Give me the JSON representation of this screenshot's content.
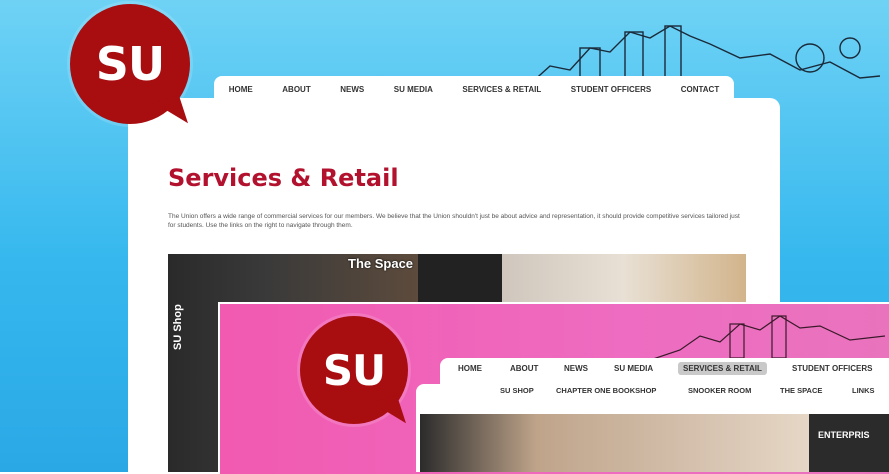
{
  "main": {
    "logo_text": "SU",
    "nav": [
      "HOME",
      "ABOUT",
      "NEWS",
      "SU MEDIA",
      "SERVICES & RETAIL",
      "STUDENT OFFICERS",
      "CONTACT"
    ],
    "page_title": "Services & Retail",
    "intro": "The Union offers a wide range of commercial services for our members. We believe that the Union shouldn't just be about advice and representation, it should provide competitive services tailored just for students. Use the links on the right to navigate through them.",
    "tiles": [
      {
        "label": "SU Shop"
      },
      {
        "label": "The Space"
      }
    ]
  },
  "overlay": {
    "logo_text": "SU",
    "nav": [
      "HOME",
      "ABOUT",
      "NEWS",
      "SU MEDIA",
      "SERVICES & RETAIL",
      "STUDENT OFFICERS"
    ],
    "active_nav": "SERVICES & RETAIL",
    "subnav": [
      "SU SHOP",
      "CHAPTER ONE BOOKSHOP",
      "SNOOKER ROOM",
      "THE SPACE",
      "LINKS"
    ],
    "tile_label": "ENTERPRIS"
  },
  "colors": {
    "brand_red": "#a80d10",
    "title_red": "#b2122e",
    "sky_blue": "#36b8ee",
    "overlay_pink": "#f15ab0"
  }
}
